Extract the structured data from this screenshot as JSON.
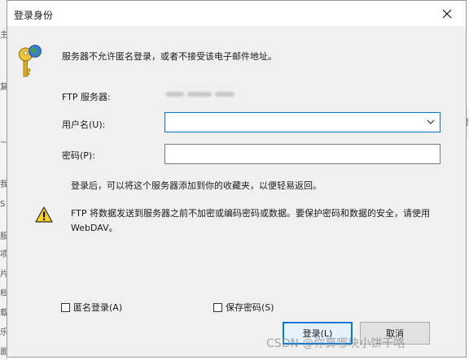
{
  "background_window": {
    "left_chars": [
      "主",
      "复",
      "~",
      "我",
      "S",
      "服",
      "项",
      "片",
      "档",
      "载",
      "乐",
      "面"
    ],
    "right_text": "付开"
  },
  "dialog": {
    "title": "登录身份",
    "intro": "服务器不允许匿名登录，或者不接受该电子邮件地址。",
    "server_label": "FTP 服务器:",
    "username_label": "用户名(U):",
    "username_value": "",
    "password_label": "密码(P):",
    "password_value": "",
    "hint": "登录后，可以将这个服务器添加到你的收藏夹，以便轻易返回。",
    "warning": "FTP 将数据发送到服务器之前不加密或编码密码或数据。要保护密码和数据的安全，请使用 WebDAV。",
    "anonymous_label": "匿名登录(A)",
    "anonymous_checked": false,
    "save_password_label": "保存密码(S)",
    "save_password_checked": false,
    "login_button": "登录(L)",
    "cancel_button": "取消"
  },
  "watermark": "CSDN @你算哪块小饼干咯",
  "colors": {
    "dialog_bg": "#f0f0f0",
    "accent": "#0078d7",
    "button_bg": "#e1e1e1"
  },
  "icons": [
    "close-icon",
    "key-icon",
    "dropdown-arrow-icon",
    "warning-icon"
  ]
}
